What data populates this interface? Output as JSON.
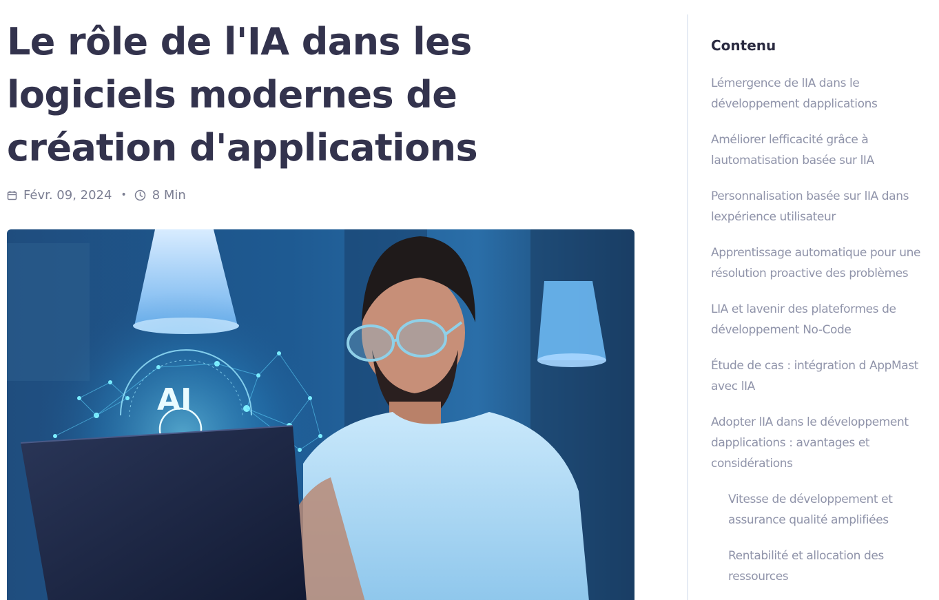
{
  "article": {
    "title": "Le rôle de l'IA dans les logiciels modernes de création d'applications",
    "date": "Févr. 09, 2024",
    "separator": "•",
    "read_time": "8 Min",
    "hero_overlay_text": "AI"
  },
  "toc": {
    "heading": "Contenu",
    "items": [
      {
        "label": "Lémergence de lIA dans le développement dapplications",
        "level": 1
      },
      {
        "label": "Améliorer lefficacité grâce à lautomatisation basée sur lIA",
        "level": 1
      },
      {
        "label": "Personnalisation basée sur lIA dans lexpérience utilisateur",
        "level": 1
      },
      {
        "label": "Apprentissage automatique pour une résolution proactive des problèmes",
        "level": 1
      },
      {
        "label": "LIA et lavenir des plateformes de développement No-Code",
        "level": 1
      },
      {
        "label": "Étude de cas : intégration d AppMast avec lIA",
        "level": 1
      },
      {
        "label": "Adopter lIA dans le développement dapplications : avantages et considérations",
        "level": 1
      },
      {
        "label": "Vitesse de développement et assurance qualité amplifiées",
        "level": 2
      },
      {
        "label": "Rentabilité et allocation des ressources",
        "level": 2
      }
    ]
  },
  "icons": {
    "date": "calendar-icon",
    "read_time": "clock-icon"
  },
  "colors": {
    "title": "#33334d",
    "meta": "#7c7f93",
    "toc_heading": "#2a2a40",
    "toc_item": "#9094aa",
    "divider": "#e6ebf4"
  }
}
